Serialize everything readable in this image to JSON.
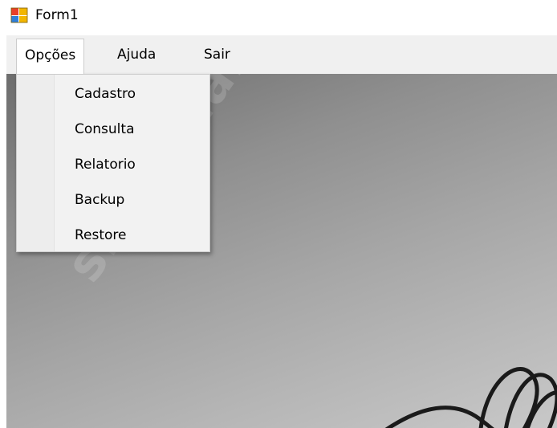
{
  "window": {
    "title": "Form1"
  },
  "menubar": {
    "items": [
      {
        "label": "Opções"
      },
      {
        "label": "Ajuda"
      },
      {
        "label": "Sair"
      }
    ]
  },
  "dropdown": {
    "items": [
      {
        "label": "Cadastro"
      },
      {
        "label": "Consulta"
      },
      {
        "label": "Relatorio"
      },
      {
        "label": "Backup"
      },
      {
        "label": "Restore"
      }
    ]
  },
  "background": {
    "watermark_text": "slideshare"
  },
  "icons": {
    "app_icon": "windows-form-icon"
  },
  "colors": {
    "menubar_bg": "#f0f0f0",
    "dropdown_bg": "#f2f2f2",
    "text": "#000000"
  }
}
